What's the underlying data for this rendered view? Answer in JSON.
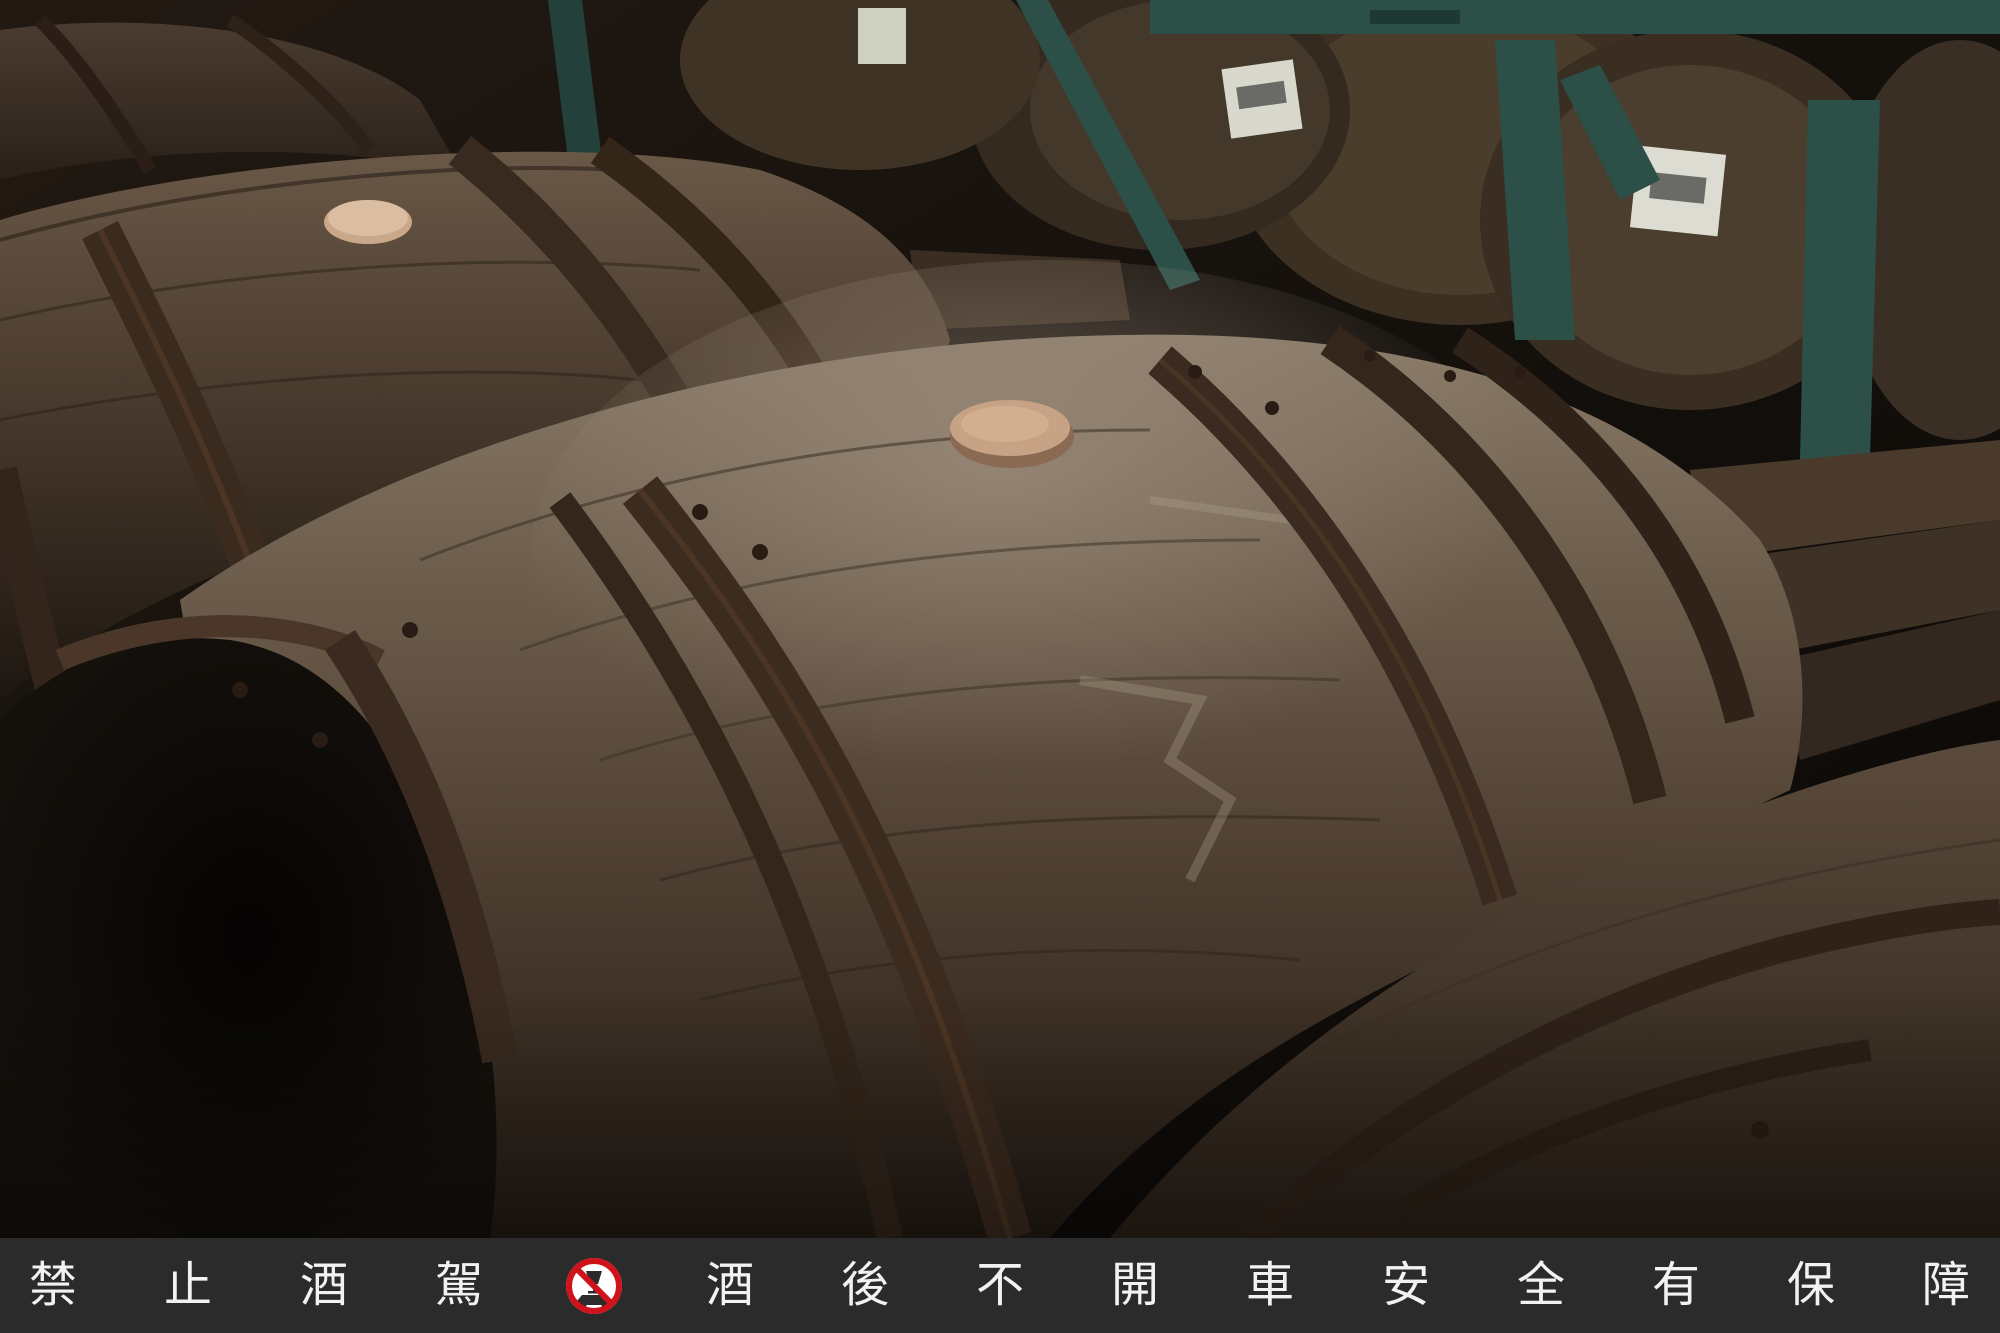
{
  "image": {
    "subject": "oak-whisky-barrels-in-warehouse",
    "colors": {
      "wood": "#5a4838",
      "iron_hoop": "#3a2a20",
      "shelf": "#2c5048",
      "label": "#e8e8e0"
    }
  },
  "banner": {
    "background": "#2b2b2b",
    "text_color": "#f2f2f2",
    "left_chars": [
      "禁",
      "止",
      "酒",
      "駕"
    ],
    "icon": "no-drink-driving-icon",
    "icon_color": "#d0121b",
    "right_chars": [
      "酒",
      "後",
      "不",
      "開",
      "車",
      "安",
      "全",
      "有",
      "保",
      "障"
    ]
  }
}
